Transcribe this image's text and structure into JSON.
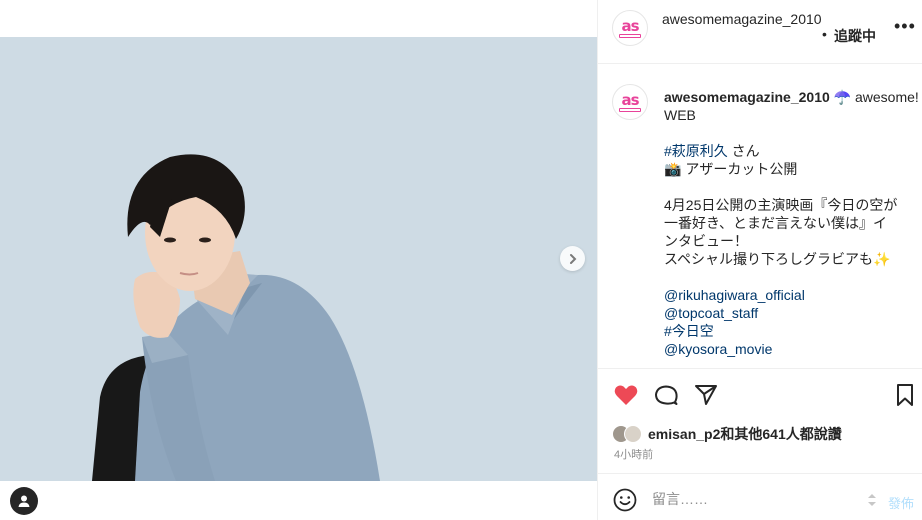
{
  "post": {
    "username": "awesomemagazine_2010",
    "follow_label": "追蹤中",
    "more_label": "•••",
    "caption": {
      "username": "awesomemagazine_2010",
      "first": "☂️ awesome! WEB",
      "lines": [
        {
          "parts": [
            {
              "t": "#萩原利久",
              "link": true
            },
            {
              "t": " さん"
            }
          ]
        },
        {
          "parts": [
            {
              "t": "📸 アザーカット公開"
            }
          ]
        },
        {
          "parts": [
            {
              "t": ""
            }
          ]
        },
        {
          "parts": [
            {
              "t": "4月25日公開の主演映画『今日の空が"
            }
          ]
        },
        {
          "parts": [
            {
              "t": "一番好き、とまだ言えない僕は』イ"
            }
          ]
        },
        {
          "parts": [
            {
              "t": "ンタビュー！"
            }
          ]
        },
        {
          "parts": [
            {
              "t": "スペシャル撮り下ろしグラビアも✨"
            }
          ]
        },
        {
          "parts": [
            {
              "t": ""
            }
          ]
        },
        {
          "parts": [
            {
              "t": "@rikuhagiwara_official",
              "link": true
            }
          ]
        },
        {
          "parts": [
            {
              "t": "@topcoat_staff",
              "link": true
            }
          ]
        },
        {
          "parts": [
            {
              "t": "#今日空",
              "link": true
            }
          ]
        },
        {
          "parts": [
            {
              "t": "@kyosora_movie",
              "link": true
            }
          ]
        }
      ]
    },
    "likes_text": "emisan_p2和其他641人都說讚",
    "time": "4小時前",
    "comment_placeholder": "留言……",
    "post_label": "發佈",
    "colors": {
      "like": "#ed4956",
      "link": "#00376b",
      "brand_pink": "#e8439a",
      "post_disabled": "#b2dffc"
    },
    "icons": [
      "heart-icon",
      "comment-icon",
      "share-icon",
      "bookmark-icon",
      "emoji-icon",
      "chevron-right-icon",
      "user-tag-icon",
      "more-icon"
    ]
  }
}
